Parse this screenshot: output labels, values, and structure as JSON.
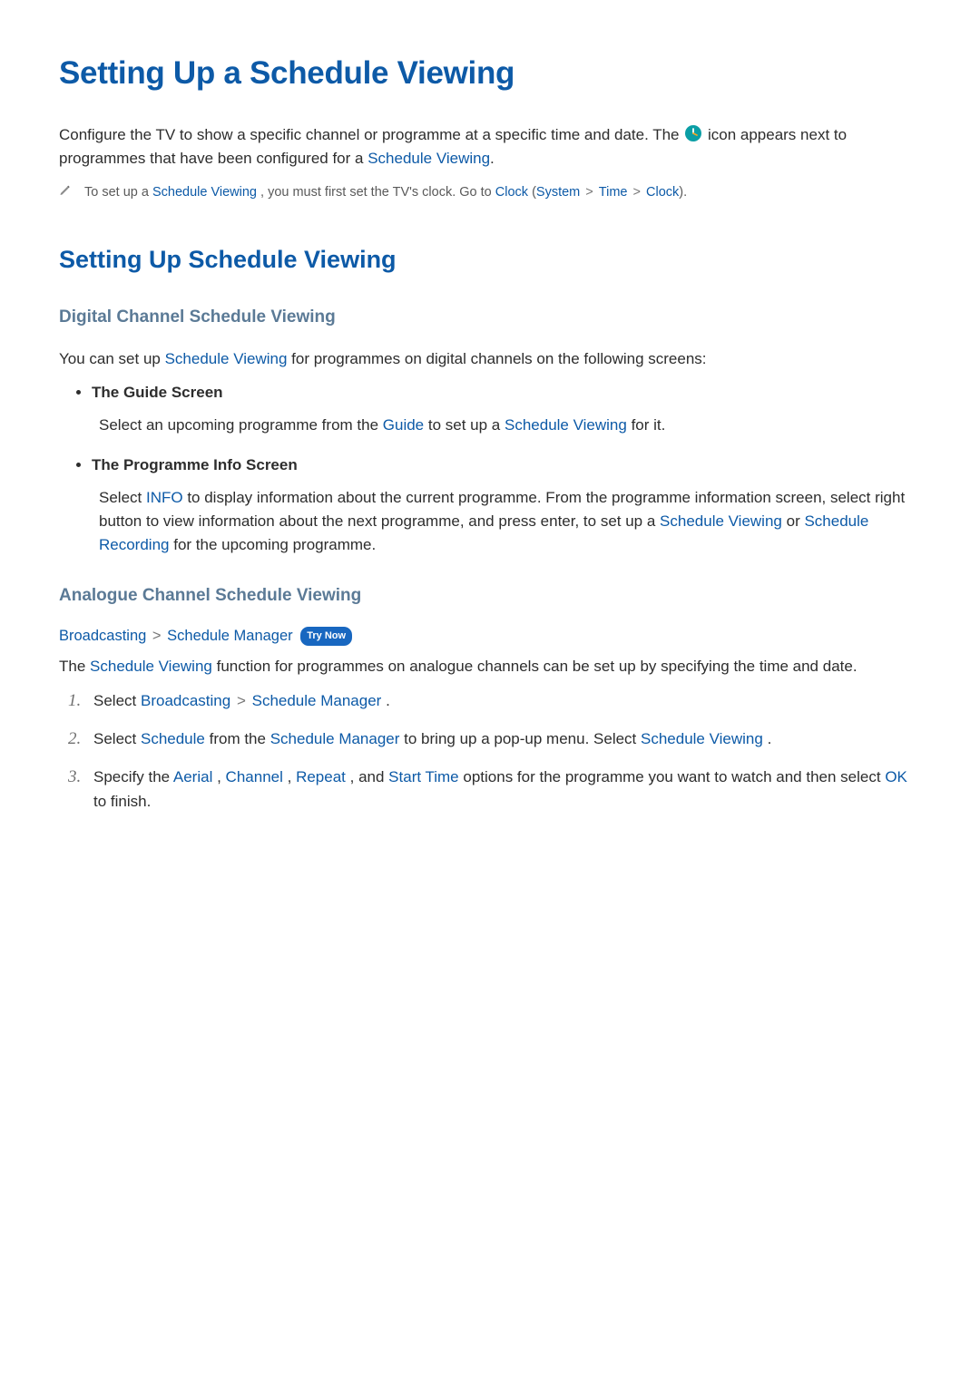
{
  "h1": "Setting Up a Schedule Viewing",
  "intro_part1": "Configure the TV to show a specific channel or programme at a specific time and date. The ",
  "intro_part2": " icon appears next to programmes that have been configured for a ",
  "term_schedule_viewing": "Schedule Viewing",
  "note": {
    "text1": "To set up a ",
    "text2": ", you must first set the TV's clock. Go to ",
    "clock": "Clock",
    "system": "System",
    "time": "Time",
    "clock2": "Clock",
    "open_paren": " (",
    "close": ")."
  },
  "h2": "Setting Up Schedule Viewing",
  "digital": {
    "heading": "Digital Channel Schedule Viewing",
    "intro_pre": "You can set up ",
    "intro_post": " for programmes on digital channels on the following screens:",
    "item1_heading": "The Guide Screen",
    "item1_body_1": "Select an upcoming programme from the ",
    "guide": "Guide",
    "item1_body_2": " to set up a ",
    "item1_body_3": " for it.",
    "item2_heading": "The Programme Info Screen",
    "item2_body_1": "Select ",
    "info": "INFO",
    "item2_body_2": " to display information about the current programme. From the programme information screen, select right button to view information about the next programme, and press enter, to set up a ",
    "item2_body_3": " or ",
    "sched_recording": "Schedule Recording",
    "item2_body_4": " for the upcoming programme."
  },
  "analogue": {
    "heading": "Analogue Channel Schedule Viewing",
    "path_broadcasting": "Broadcasting",
    "path_sep": " > ",
    "path_sm": "Schedule Manager",
    "try_now": "Try Now",
    "desc_pre": "The ",
    "desc_post": " function for programmes on analogue channels can be set up by specifying the time and date.",
    "step1_pre": "Select ",
    "step1_b": "Broadcasting",
    "step1_sm": "Schedule Manager",
    "step1_end": ".",
    "step2_pre": "Select ",
    "step2_sched": "Schedule",
    "step2_mid1": " from the ",
    "step2_sm": "Schedule Manager",
    "step2_mid2": " to bring up a pop-up menu. Select ",
    "step2_sv": "Schedule Viewing",
    "step2_end": ".",
    "step3_pre": "Specify the ",
    "step3_aerial": "Aerial",
    "step3_comma": ", ",
    "step3_channel": "Channel",
    "step3_repeat": "Repeat",
    "step3_and": ", and ",
    "step3_start": "Start Time",
    "step3_mid": " options for the programme you want to watch and then select ",
    "step3_ok": "OK",
    "step3_end": " to finish."
  }
}
